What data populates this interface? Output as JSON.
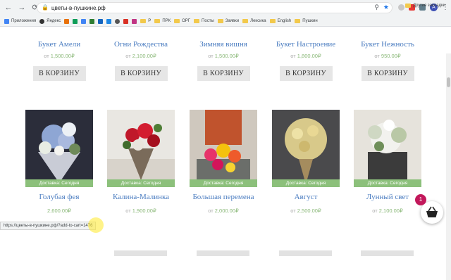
{
  "browser": {
    "url": "цветы-в-пушкине.рф",
    "profile_initial": "A",
    "bookmarks": [
      "Приложения",
      "Яндекс",
      "Р",
      "ПРК",
      "ОРГ",
      "Посты",
      "Заявки",
      "Лексика",
      "English",
      "Пушкин"
    ],
    "other_bookmarks": "Другие закладки"
  },
  "top_row": [
    {
      "name": "Букет Амели",
      "price_from": "от",
      "price": "1,500.00₽",
      "button": "В КОРЗИНУ"
    },
    {
      "name": "Огни Рождества",
      "price_from": "от",
      "price": "2,100.00₽",
      "button": "В КОРЗИНУ"
    },
    {
      "name": "Зимняя вишня",
      "price_from": "от",
      "price": "1,500.00₽",
      "button": "В КОРЗИНУ"
    },
    {
      "name": "Букет Настроение",
      "price_from": "от",
      "price": "1,800.00₽",
      "button": "В КОРЗИНУ"
    },
    {
      "name": "Букет Нежность",
      "price_from": "от",
      "price": "950.00₽",
      "button": "В КОРЗИНУ"
    }
  ],
  "bottom_row": [
    {
      "name": "Голубая фея",
      "price_from": "",
      "price": "2,600.00₽",
      "badge": "Доставка: Сегодня"
    },
    {
      "name": "Калина-Малинка",
      "price_from": "от",
      "price": "1,900.00₽",
      "badge": "Доставка: Сегодня"
    },
    {
      "name": "Большая перемена",
      "price_from": "от",
      "price": "2,000.00₽",
      "badge": "Доставка: Сегодня"
    },
    {
      "name": "Август",
      "price_from": "от",
      "price": "2,500.00₽",
      "badge": "Доставка: Сегодня"
    },
    {
      "name": "Лунный свет",
      "price_from": "от",
      "price": "2,100.00₽",
      "badge": "Доставка: Сегодня"
    }
  ],
  "status_url": "https://цветы-в-пушкине.рф/?add-to-cart=1476",
  "cart": {
    "count": "1"
  },
  "colors": {
    "accent": "#4a7cc0",
    "price": "#8ab878",
    "badge": "#8cc07b",
    "cart_badge": "#c2185b"
  }
}
